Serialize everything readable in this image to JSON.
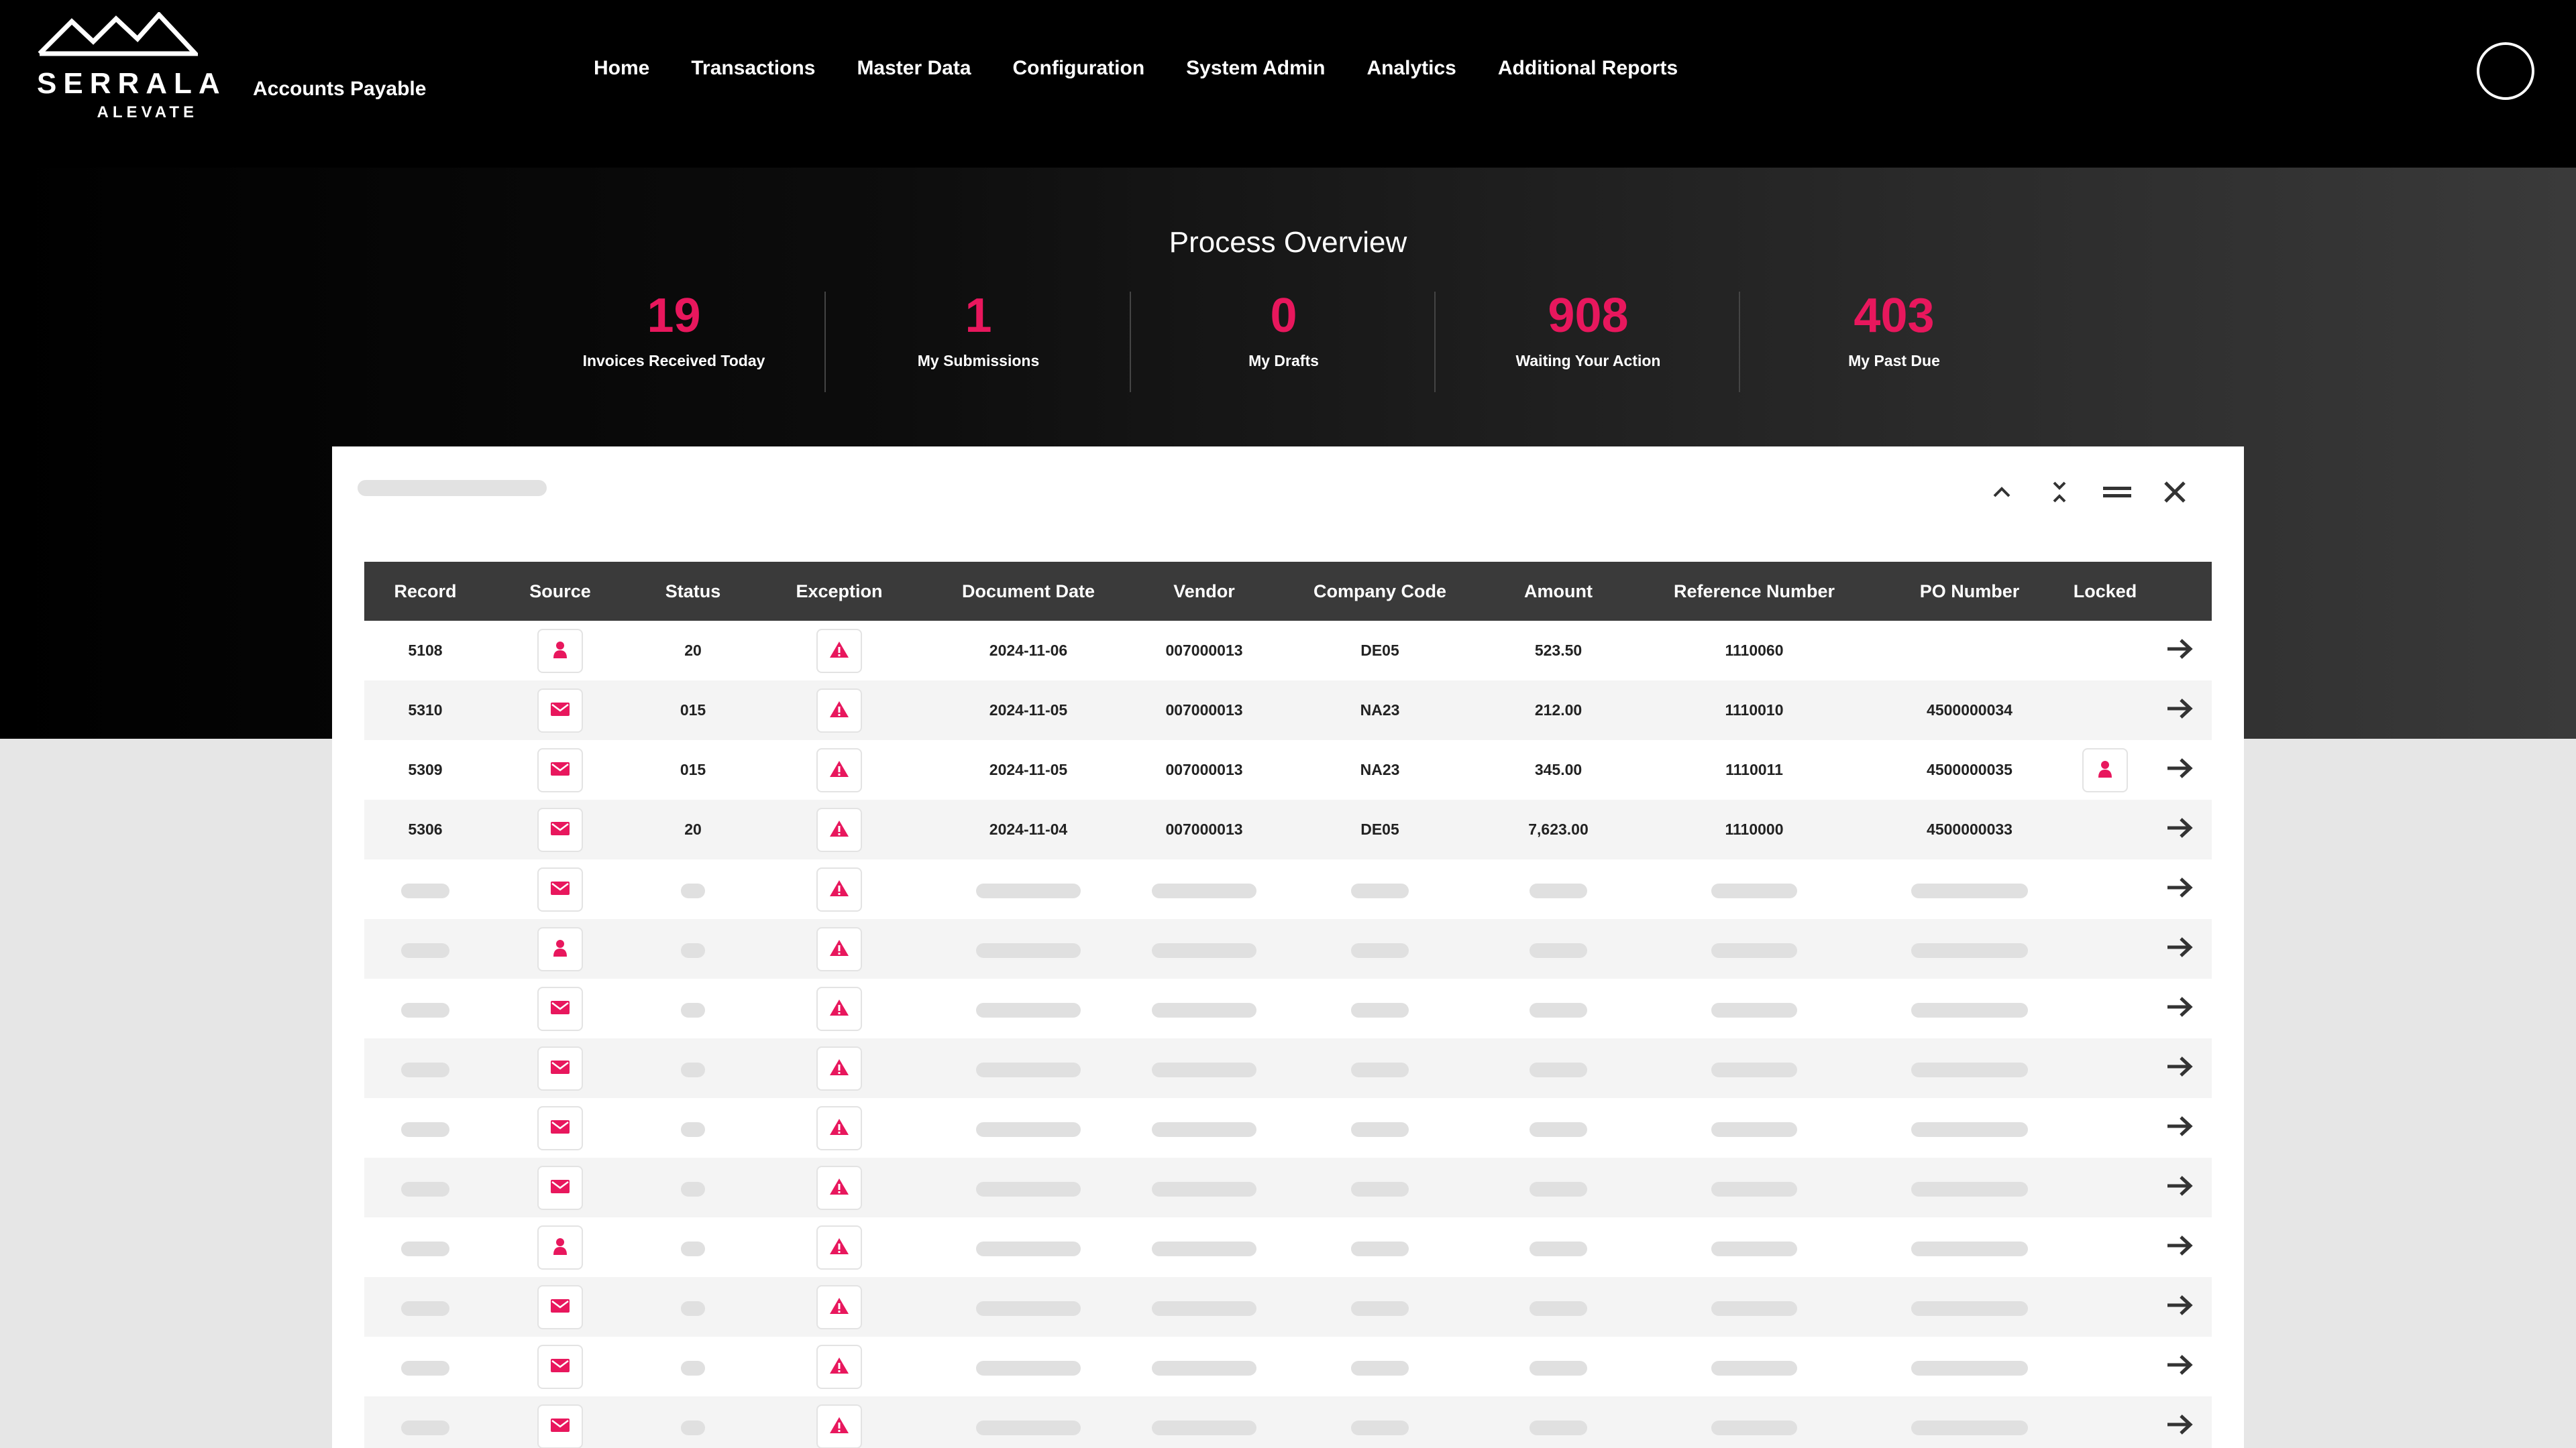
{
  "brand": {
    "name": "SERRALA",
    "sub": "ALEVATE"
  },
  "app": {
    "name": "Accounts Payable"
  },
  "nav": [
    "Home",
    "Transactions",
    "Master Data",
    "Configuration",
    "System Admin",
    "Analytics",
    "Additional Reports"
  ],
  "overview": {
    "title": "Process Overview",
    "kpis": [
      {
        "value": "19",
        "label": "Invoices Received Today"
      },
      {
        "value": "1",
        "label": "My Submissions"
      },
      {
        "value": "0",
        "label": "My Drafts"
      },
      {
        "value": "908",
        "label": "Waiting Your Action"
      },
      {
        "value": "403",
        "label": "My Past Due"
      }
    ]
  },
  "colors": {
    "accent": "#e8175d",
    "header_bg": "#3a3a3a"
  },
  "panel_controls": [
    "chevron-up-icon",
    "collapse-icon",
    "menu-icon",
    "close-icon"
  ],
  "table": {
    "columns": [
      "Record",
      "Source",
      "Status",
      "Exception",
      "Document Date",
      "Vendor",
      "Company Code",
      "Amount",
      "Reference Number",
      "PO Number",
      "Locked"
    ],
    "rows": [
      {
        "record": "5108",
        "source": "user",
        "status": "20",
        "date": "2024-11-06",
        "vendor": "007000013",
        "company": "DE05",
        "amount": "523.50",
        "reference": "1110060",
        "po": "",
        "locked": false
      },
      {
        "record": "5310",
        "source": "mail",
        "status": "015",
        "date": "2024-11-05",
        "vendor": "007000013",
        "company": "NA23",
        "amount": "212.00",
        "reference": "1110010",
        "po": "4500000034",
        "locked": false
      },
      {
        "record": "5309",
        "source": "mail",
        "status": "015",
        "date": "2024-11-05",
        "vendor": "007000013",
        "company": "NA23",
        "amount": "345.00",
        "reference": "1110011",
        "po": "4500000035",
        "locked": true
      },
      {
        "record": "5306",
        "source": "mail",
        "status": "20",
        "date": "2024-11-04",
        "vendor": "007000013",
        "company": "DE05",
        "amount": "7,623.00",
        "reference": "1110000",
        "po": "4500000033",
        "locked": false
      }
    ],
    "loading_rows": [
      "mail",
      "user",
      "mail",
      "mail",
      "mail",
      "mail",
      "user",
      "mail",
      "mail",
      "mail"
    ]
  }
}
